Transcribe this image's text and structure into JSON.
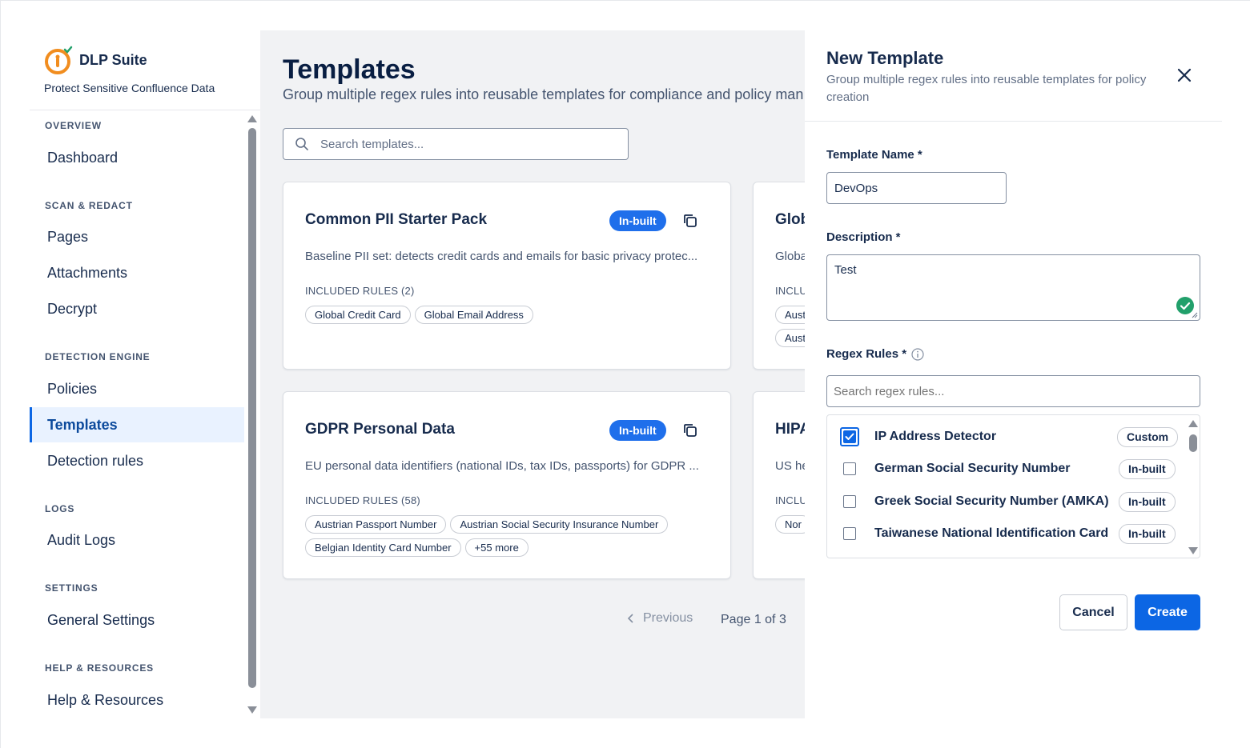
{
  "brand": {
    "name": "DLP Suite",
    "subtitle": "Protect Sensitive Confluence Data"
  },
  "sidebar": {
    "sections": [
      {
        "label": "OVERVIEW",
        "items": [
          "Dashboard"
        ]
      },
      {
        "label": "SCAN & REDACT",
        "items": [
          "Pages",
          "Attachments",
          "Decrypt"
        ]
      },
      {
        "label": "DETECTION ENGINE",
        "items": [
          "Policies",
          "Templates",
          "Detection rules"
        ]
      },
      {
        "label": "LOGS",
        "items": [
          "Audit Logs"
        ]
      },
      {
        "label": "SETTINGS",
        "items": [
          "General Settings"
        ]
      },
      {
        "label": "HELP & RESOURCES",
        "items": [
          "Help & Resources"
        ]
      }
    ],
    "active_item": "Templates"
  },
  "main": {
    "title": "Templates",
    "subtitle": "Group multiple regex rules into reusable templates for compliance and policy man",
    "search_placeholder": "Search templates...",
    "cards": [
      {
        "title": "Common PII Starter Pack",
        "badge": "In-built",
        "description": "Baseline PII set: detects credit cards and emails for basic privacy protec...",
        "rules_label": "INCLUDED RULES (2)",
        "chips": [
          "Global Credit Card",
          "Global Email Address"
        ]
      },
      {
        "title": "Glob",
        "description": "Globa",
        "rules_label": "INCLU",
        "chips": [
          "Aust",
          "Aust"
        ]
      },
      {
        "title": "GDPR Personal Data",
        "badge": "In-built",
        "description": "EU personal data identifiers (national IDs, tax IDs, passports) for GDPR ...",
        "rules_label": "INCLUDED RULES (58)",
        "chips": [
          "Austrian Passport Number",
          "Austrian Social Security Insurance Number",
          "Belgian Identity Card Number",
          "+55 more"
        ]
      },
      {
        "title": "HIPA",
        "description": "US he",
        "rules_label": "INCLU",
        "chips": [
          "Nor"
        ]
      }
    ],
    "pagination": {
      "previous": "Previous",
      "page_info": "Page 1 of 3"
    }
  },
  "drawer": {
    "title": "New Template",
    "subtitle": "Group multiple regex rules into reusable templates for policy creation",
    "template_name_label": "Template Name *",
    "template_name_value": "DevOps",
    "description_label": "Description *",
    "description_value": "Test",
    "regex_rules_label": "Regex Rules *",
    "regex_search_placeholder": "Search regex rules...",
    "rules": [
      {
        "name": "IP Address Detector",
        "tag": "Custom",
        "checked": true
      },
      {
        "name": "German Social Security Number",
        "tag": "In-built",
        "checked": false
      },
      {
        "name": "Greek Social Security Number (AMKA)",
        "tag": "In-built",
        "checked": false
      },
      {
        "name": "Taiwanese National Identification Card",
        "tag": "In-built",
        "checked": false
      }
    ],
    "cancel_label": "Cancel",
    "create_label": "Create"
  },
  "colors": {
    "primary": "#0c66e4",
    "badge": "#1f6feb",
    "success": "#22a06b",
    "logo": "#f18d1f"
  }
}
